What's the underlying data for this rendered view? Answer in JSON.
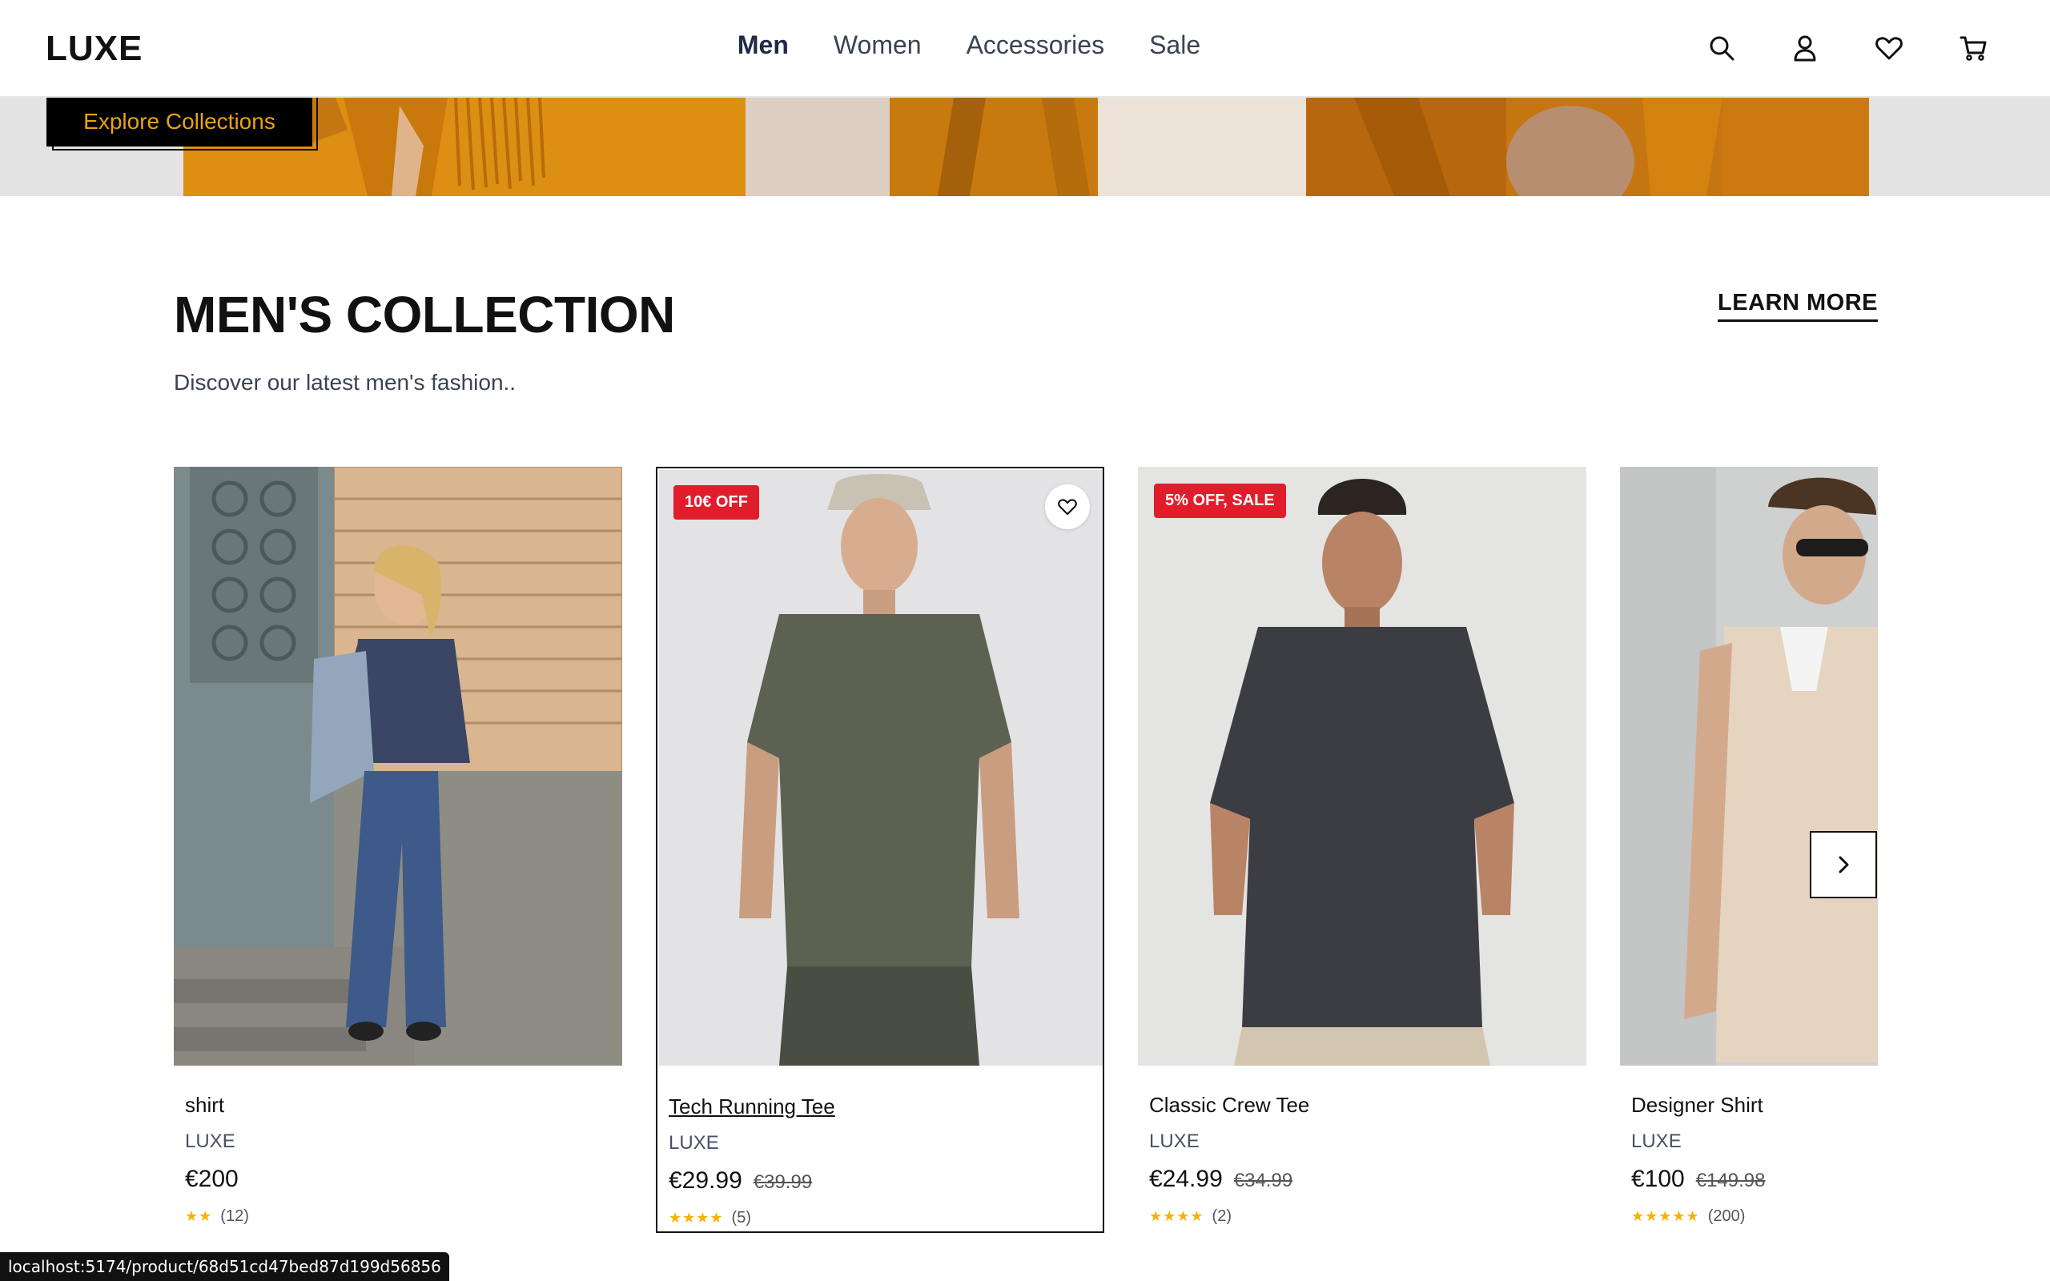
{
  "header": {
    "logo": "LUXE",
    "nav": [
      {
        "label": "Men",
        "active": true
      },
      {
        "label": "Women",
        "active": false
      },
      {
        "label": "Accessories",
        "active": false
      },
      {
        "label": "Sale",
        "active": false
      }
    ],
    "icons": [
      "search-icon",
      "user-icon",
      "heart-icon",
      "cart-icon"
    ]
  },
  "hero": {
    "button_label": "Explore Collections",
    "button_text_color": "#e8a314"
  },
  "section": {
    "title": "MEN'S COLLECTION",
    "subtitle": "Discover our latest men's fashion..",
    "learn_more": "LEARN MORE"
  },
  "products": [
    {
      "name": "shirt",
      "brand": "LUXE",
      "price": "€200",
      "old_price": "",
      "badge": "",
      "stars": "★★",
      "reviews": "(12)"
    },
    {
      "name": "Tech Running Tee",
      "brand": "LUXE",
      "price": "€29.99",
      "old_price": "€39.99",
      "badge": "10€ OFF",
      "stars": "★★★★",
      "reviews": "(5)"
    },
    {
      "name": "Classic Crew Tee",
      "brand": "LUXE",
      "price": "€24.99",
      "old_price": "€34.99",
      "badge": "5% OFF, SALE",
      "stars": "★★★★",
      "reviews": "(2)"
    },
    {
      "name": "Designer Shirt",
      "brand": "LUXE",
      "price": "€100",
      "old_price": "€149.98",
      "badge": "",
      "stars": "★★★★★",
      "reviews": "(200)"
    }
  ],
  "colors": {
    "accent": "#e8a314",
    "badge": "#e11d2c",
    "star": "#f5b301"
  },
  "status_url": "localhost:5174/product/68d51cd47bed87d199d56856"
}
